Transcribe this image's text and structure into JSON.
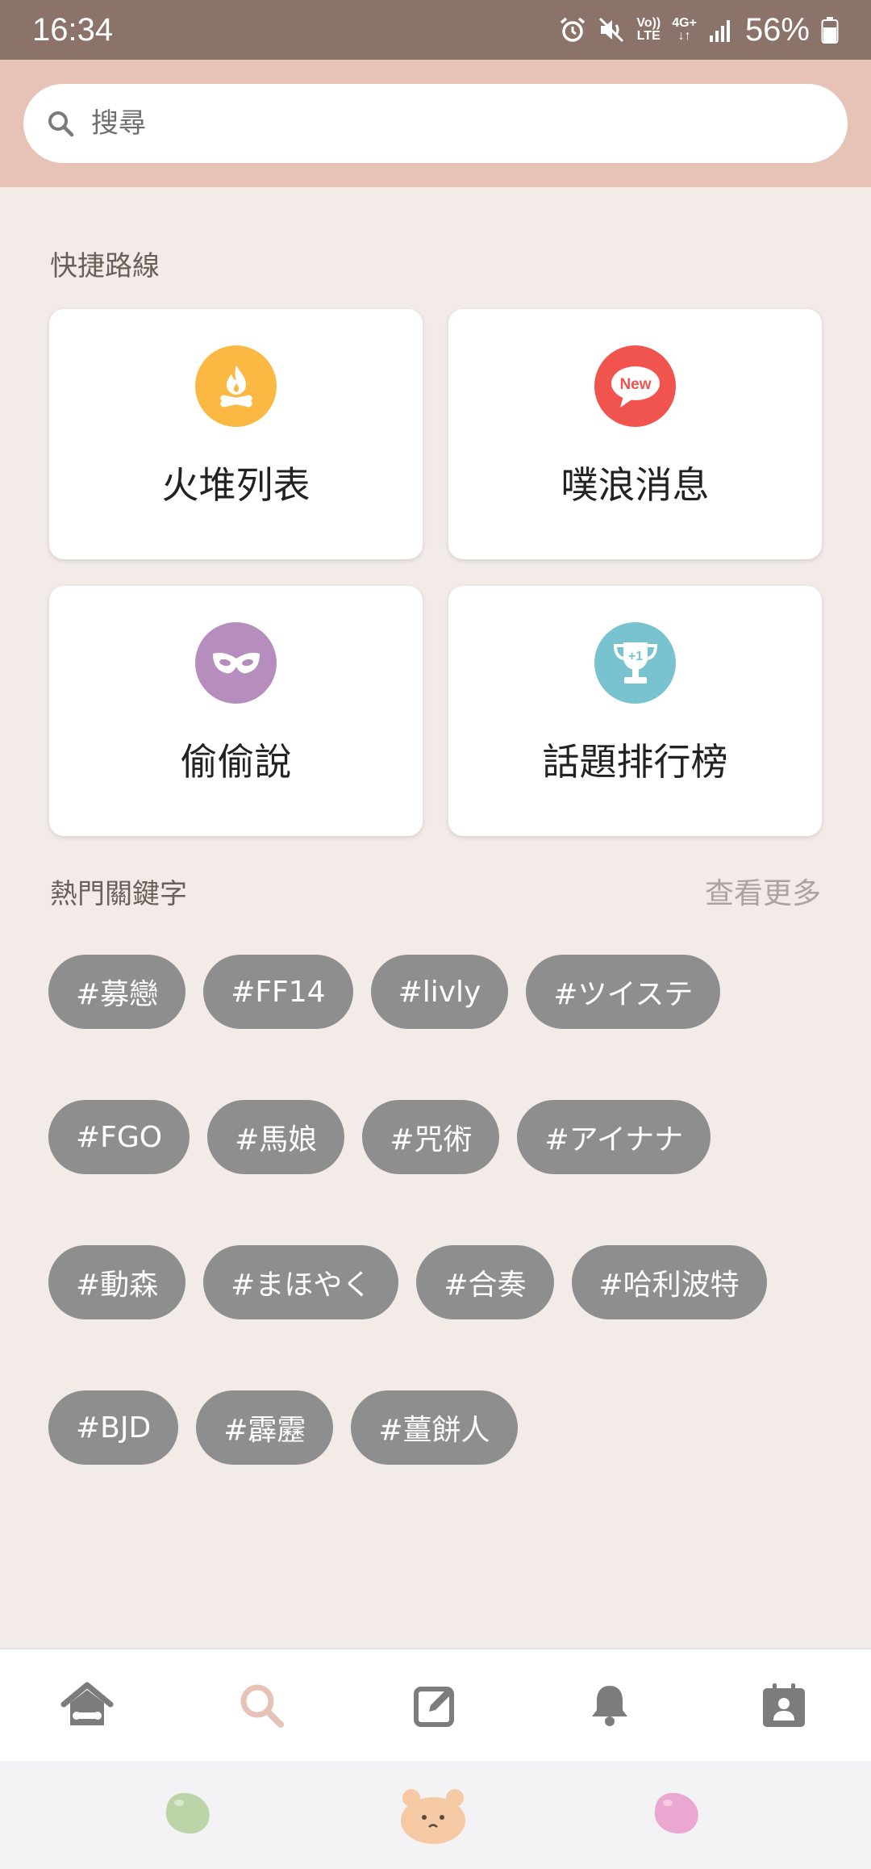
{
  "status_bar": {
    "time": "16:34",
    "volte_top": "Vo))",
    "volte_bottom": "LTE",
    "network": "4G+",
    "battery_percent": "56%",
    "icons": [
      "alarm-icon",
      "mute-icon",
      "signal-icon",
      "battery-icon"
    ]
  },
  "search": {
    "placeholder": "搜尋",
    "icon": "search-icon"
  },
  "shortcuts": {
    "title": "快捷路線",
    "items": [
      {
        "label": "火堆列表",
        "icon": "campfire-icon",
        "color": "#fbb944"
      },
      {
        "label": "噗浪消息",
        "icon": "new-message-icon",
        "badge": "New",
        "color": "#f1534f"
      },
      {
        "label": "偷偷說",
        "icon": "mask-icon",
        "color": "#b58ebe"
      },
      {
        "label": "話題排行榜",
        "icon": "trophy-icon",
        "badge": "+1",
        "color": "#79c2cf"
      }
    ]
  },
  "hot_keywords": {
    "title": "熱門關鍵字",
    "see_more": "查看更多",
    "tags": [
      "#募戀",
      "#FF14",
      "#livly",
      "#ツイステ",
      "#FGO",
      "#馬娘",
      "#咒術",
      "#アイナナ",
      "#動森",
      "#まほやく",
      "#合奏",
      "#哈利波特",
      "#BJD",
      "#霹靂",
      "#薑餅人"
    ]
  },
  "bottom_nav": {
    "items": [
      "home-icon",
      "search-icon",
      "compose-icon",
      "bell-icon",
      "profile-icon"
    ],
    "active": "search-icon",
    "active_color": "#e6c3b6",
    "inactive_color": "#7c7c7c"
  },
  "bean_bar": {
    "items": [
      "green-bean-icon",
      "bear-face-icon",
      "pink-bean-icon"
    ]
  }
}
